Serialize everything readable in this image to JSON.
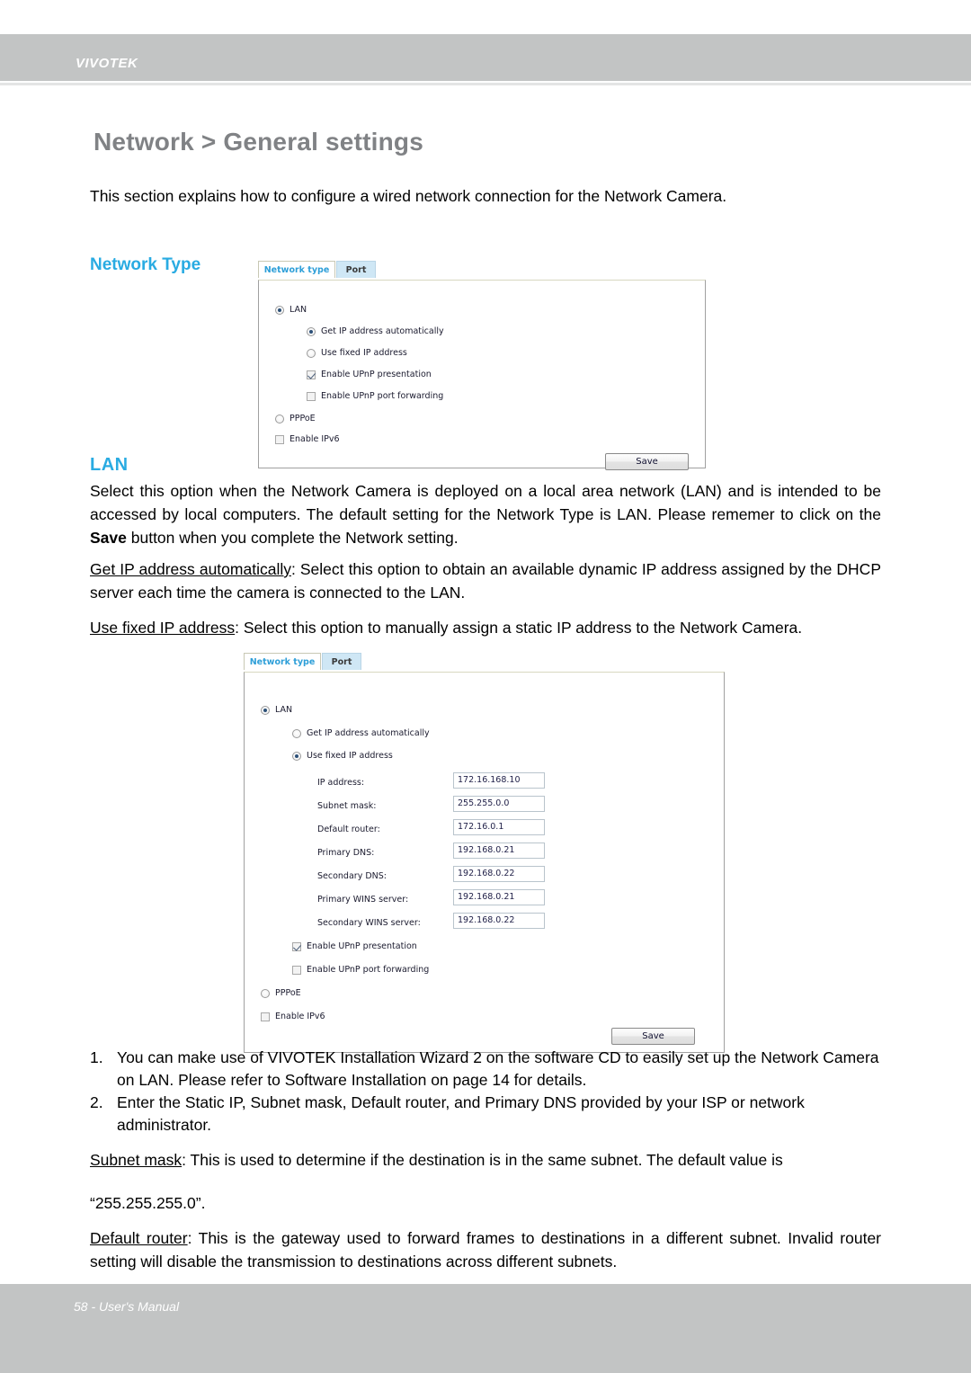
{
  "header": {
    "brand": "VIVOTEK"
  },
  "footer": {
    "page_label": "58 - User's Manual"
  },
  "page": {
    "title": "Network > General settings",
    "intro": "This section explains how to configure a wired network connection for the Network Camera.",
    "network_type_heading": "Network Type",
    "lan_heading": "LAN",
    "lan_paragraph_1": "Select this option when the Network Camera is deployed on a local area network (LAN) and is intended to be accessed by local computers. The default setting for the Network Type is LAN. Please rememer to click on the ",
    "lan_paragraph_1_bold": "Save",
    "lan_paragraph_1_rest": " button when you complete the Network setting.",
    "get_ip_term": "Get IP address automatically",
    "get_ip_body": ": Select this option to obtain an available dynamic IP address assigned by the DHCP server each time the camera is connected to the LAN.",
    "use_fixed_term": "Use fixed IP address",
    "use_fixed_body": ": Select this option to manually assign a static IP address to the Network Camera.",
    "numbered": [
      {
        "num": "1.",
        "text": "You can make use of VIVOTEK Installation Wizard 2 on the software CD to easily set up the Network Camera on LAN. Please refer to Software Installation on page 14 for details."
      },
      {
        "num": "2.",
        "text": "Enter the Static IP, Subnet mask, Default router, and Primary DNS provided by your ISP or network administrator."
      }
    ],
    "subnet_term": "Subnet mask",
    "subnet_body": ": This is used to determine if the destination is in the same subnet. The default value is",
    "subnet_value": "“255.255.255.0”.",
    "router_term": "Default router",
    "router_body": ": This is the gateway used to forward frames to destinations in a different subnet. Invalid router setting will disable the transmission to destinations across different subnets."
  },
  "panel_a": {
    "tabs": [
      {
        "label": "Network type",
        "active": true
      },
      {
        "label": "Port",
        "active": false
      }
    ],
    "lan_label": "LAN",
    "get_ip_label": "Get IP address automatically",
    "use_fixed_label": "Use fixed IP address",
    "upnp_presentation_label": "Enable UPnP presentation",
    "upnp_forwarding_label": "Enable UPnP port forwarding",
    "pppoe_label": "PPPoE",
    "ipv6_label": "Enable IPv6",
    "save_label": "Save",
    "states": {
      "lan": "checked",
      "get_ip": "checked",
      "use_fixed": "unchecked",
      "upnp_presentation": "checked",
      "upnp_forwarding": "unchecked",
      "pppoe": "unchecked",
      "ipv6": "unchecked"
    }
  },
  "panel_b": {
    "tabs": [
      {
        "label": "Network type",
        "active": true
      },
      {
        "label": "Port",
        "active": false
      }
    ],
    "lan_label": "LAN",
    "get_ip_label": "Get IP address automatically",
    "use_fixed_label": "Use fixed IP address",
    "fields": [
      {
        "label": "IP address:",
        "value": "172.16.168.10"
      },
      {
        "label": "Subnet mask:",
        "value": "255.255.0.0"
      },
      {
        "label": "Default router:",
        "value": "172.16.0.1"
      },
      {
        "label": "Primary DNS:",
        "value": "192.168.0.21"
      },
      {
        "label": "Secondary DNS:",
        "value": "192.168.0.22"
      },
      {
        "label": "Primary WINS server:",
        "value": "192.168.0.21"
      },
      {
        "label": "Secondary WINS server:",
        "value": "192.168.0.22"
      }
    ],
    "upnp_presentation_label": "Enable UPnP presentation",
    "upnp_forwarding_label": "Enable UPnP port forwarding",
    "pppoe_label": "PPPoE",
    "ipv6_label": "Enable IPv6",
    "save_label": "Save",
    "states": {
      "lan": "checked",
      "get_ip": "unchecked",
      "use_fixed": "checked",
      "upnp_presentation": "checked",
      "upnp_forwarding": "unchecked",
      "pppoe": "unchecked",
      "ipv6": "unchecked"
    }
  },
  "colors": {
    "header_gray": "#c2c4c4",
    "title_gray": "#808285",
    "accent_blue": "#29abe2",
    "tab_inactive_blue": "#cfe7f5"
  }
}
